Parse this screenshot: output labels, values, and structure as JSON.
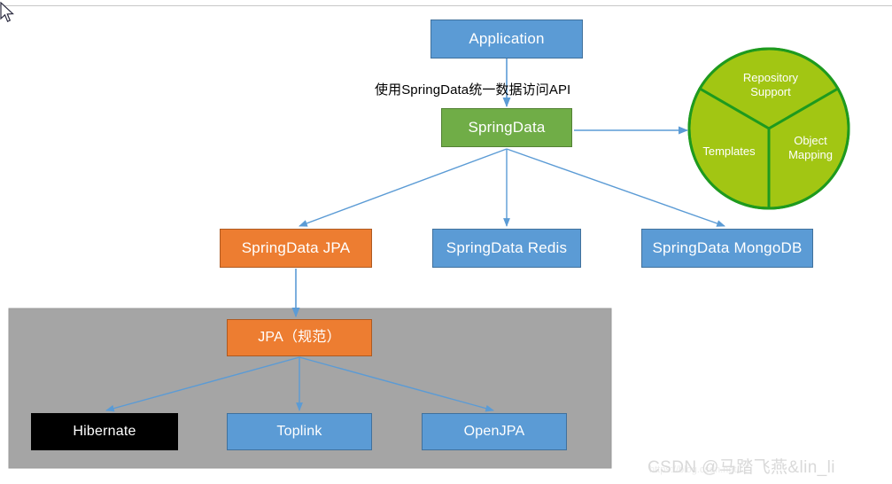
{
  "diagram": {
    "title_annotation": "使用SpringData统一数据访问API",
    "colors": {
      "blue": "#5B9BD5",
      "blue_border": "#41719C",
      "green": "#70AD47",
      "green_border": "#538135",
      "orange": "#ED7D31",
      "orange_border": "#AE5A21",
      "black": "#000000",
      "grey_panel": "#A5A5A5",
      "pie_fill": "#A2C613",
      "pie_stroke": "#1E9A1E",
      "connector": "#5B9BD5"
    },
    "nodes": {
      "application": "Application",
      "springdata": "SpringData",
      "springdata_jpa": "SpringData JPA",
      "springdata_redis": "SpringData Redis",
      "springdata_mongodb": "SpringData MongoDB",
      "jpa_spec": "JPA（规范）",
      "hibernate": "Hibernate",
      "toplink": "Toplink",
      "openjpa": "OpenJPA"
    },
    "pie": {
      "segments": [
        {
          "label": "Repository\nSupport",
          "share": 33.3
        },
        {
          "label": "Object\nMapping",
          "share": 33.3
        },
        {
          "label": "Templates",
          "share": 33.3
        }
      ]
    },
    "watermark": {
      "text": "CSDN @马踏飞燕&lin_li",
      "url": "https://blog.csdn.net/..."
    }
  }
}
